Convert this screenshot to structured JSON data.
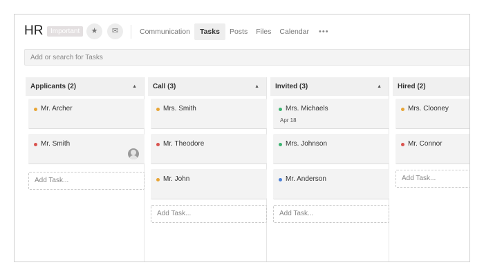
{
  "header": {
    "title": "HR",
    "badge": "Important",
    "star_icon": "star-icon",
    "mail_icon": "mail-icon",
    "nav": [
      "Communication",
      "Tasks",
      "Posts",
      "Files",
      "Calendar"
    ],
    "active_nav": "Tasks",
    "more_icon": "more-dots-icon"
  },
  "search": {
    "placeholder": "Add or search for Tasks",
    "value": ""
  },
  "colors": {
    "orange": "#e8a535",
    "red": "#d9534f",
    "green": "#3cb371",
    "blue": "#4a7fd6"
  },
  "columns": [
    {
      "title": "Applicants (2)",
      "cards": [
        {
          "name": "Mr. Archer",
          "dot": "orange"
        },
        {
          "name": "Mr. Smith",
          "dot": "red",
          "avatar": true
        }
      ],
      "add_label": "Add Task..."
    },
    {
      "title": "Call (3)",
      "cards": [
        {
          "name": "Mrs. Smith",
          "dot": "orange"
        },
        {
          "name": "Mr. Theodore",
          "dot": "red"
        },
        {
          "name": "Mr. John",
          "dot": "orange"
        }
      ],
      "add_label": "Add Task..."
    },
    {
      "title": "Invited (3)",
      "cards": [
        {
          "name": "Mrs. Michaels",
          "dot": "green",
          "date": "Apr 18"
        },
        {
          "name": "Mrs. Johnson",
          "dot": "green"
        },
        {
          "name": "Mr. Anderson",
          "dot": "blue"
        }
      ],
      "add_label": "Add Task..."
    },
    {
      "title": "Hired (2)",
      "cards": [
        {
          "name": "Mrs. Clooney",
          "dot": "orange"
        },
        {
          "name": "Mr. Connor",
          "dot": "red"
        }
      ],
      "add_label": "Add Task..."
    }
  ]
}
